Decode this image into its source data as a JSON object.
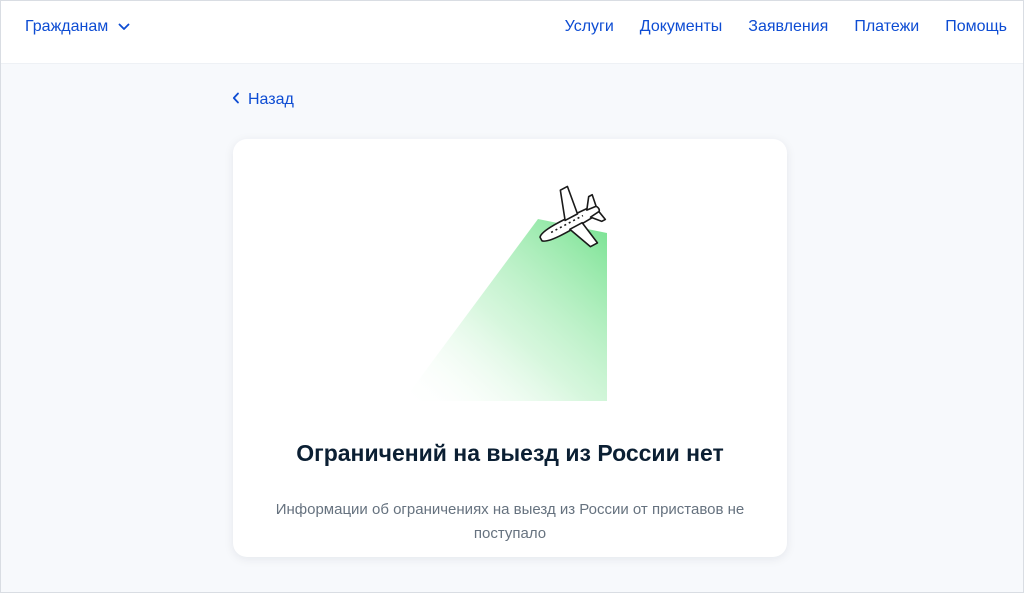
{
  "header": {
    "role_label": "Гражданам",
    "nav": [
      {
        "label": "Услуги"
      },
      {
        "label": "Документы"
      },
      {
        "label": "Заявления"
      },
      {
        "label": "Платежи"
      },
      {
        "label": "Помощь"
      }
    ]
  },
  "back_link": {
    "label": "Назад"
  },
  "card": {
    "title": "Ограничений на выезд из России нет",
    "description": "Информации об ограничениях на выезд из России от приставов не поступало"
  },
  "colors": {
    "link": "#0d4cd3",
    "beam": "#6fe08a",
    "text": "#0b1f33",
    "muted": "#66727f"
  },
  "icons": [
    "chevron-down-icon",
    "chevron-left-icon",
    "airplane-icon"
  ]
}
